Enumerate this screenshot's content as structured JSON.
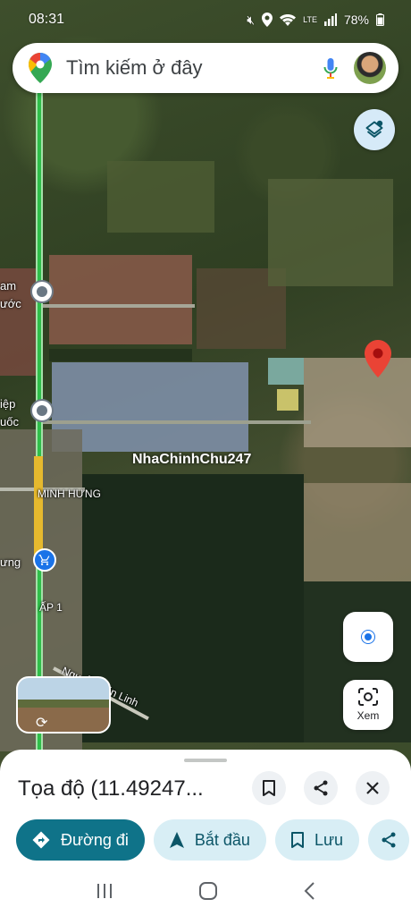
{
  "status_bar": {
    "time": "08:31",
    "battery": "78%",
    "network": "LTE"
  },
  "search": {
    "placeholder": "Tìm kiếm ở đây"
  },
  "map": {
    "labels": {
      "place_1": "am",
      "place_1b": "ước",
      "place_2": "iệp",
      "place_2b": "uốc",
      "place_3": "MINH HƯNG",
      "place_4": "ưng",
      "place_5": "ẤP 1",
      "place_6": "Nguyễn Văn Linh"
    },
    "watermark": "NhaChinhChu247"
  },
  "controls": {
    "view_label": "Xem"
  },
  "place_sheet": {
    "title": "Tọa độ (11.49247..."
  },
  "actions": {
    "directions": "Đường đi",
    "start": "Bắt đầu",
    "save": "Lưu"
  },
  "colors": {
    "primary": "#0f7389",
    "secondary_bg": "#d8eef5",
    "pin_red": "#ea4335",
    "location_blue": "#1a73e8",
    "main_road": "#2fbf4a"
  }
}
